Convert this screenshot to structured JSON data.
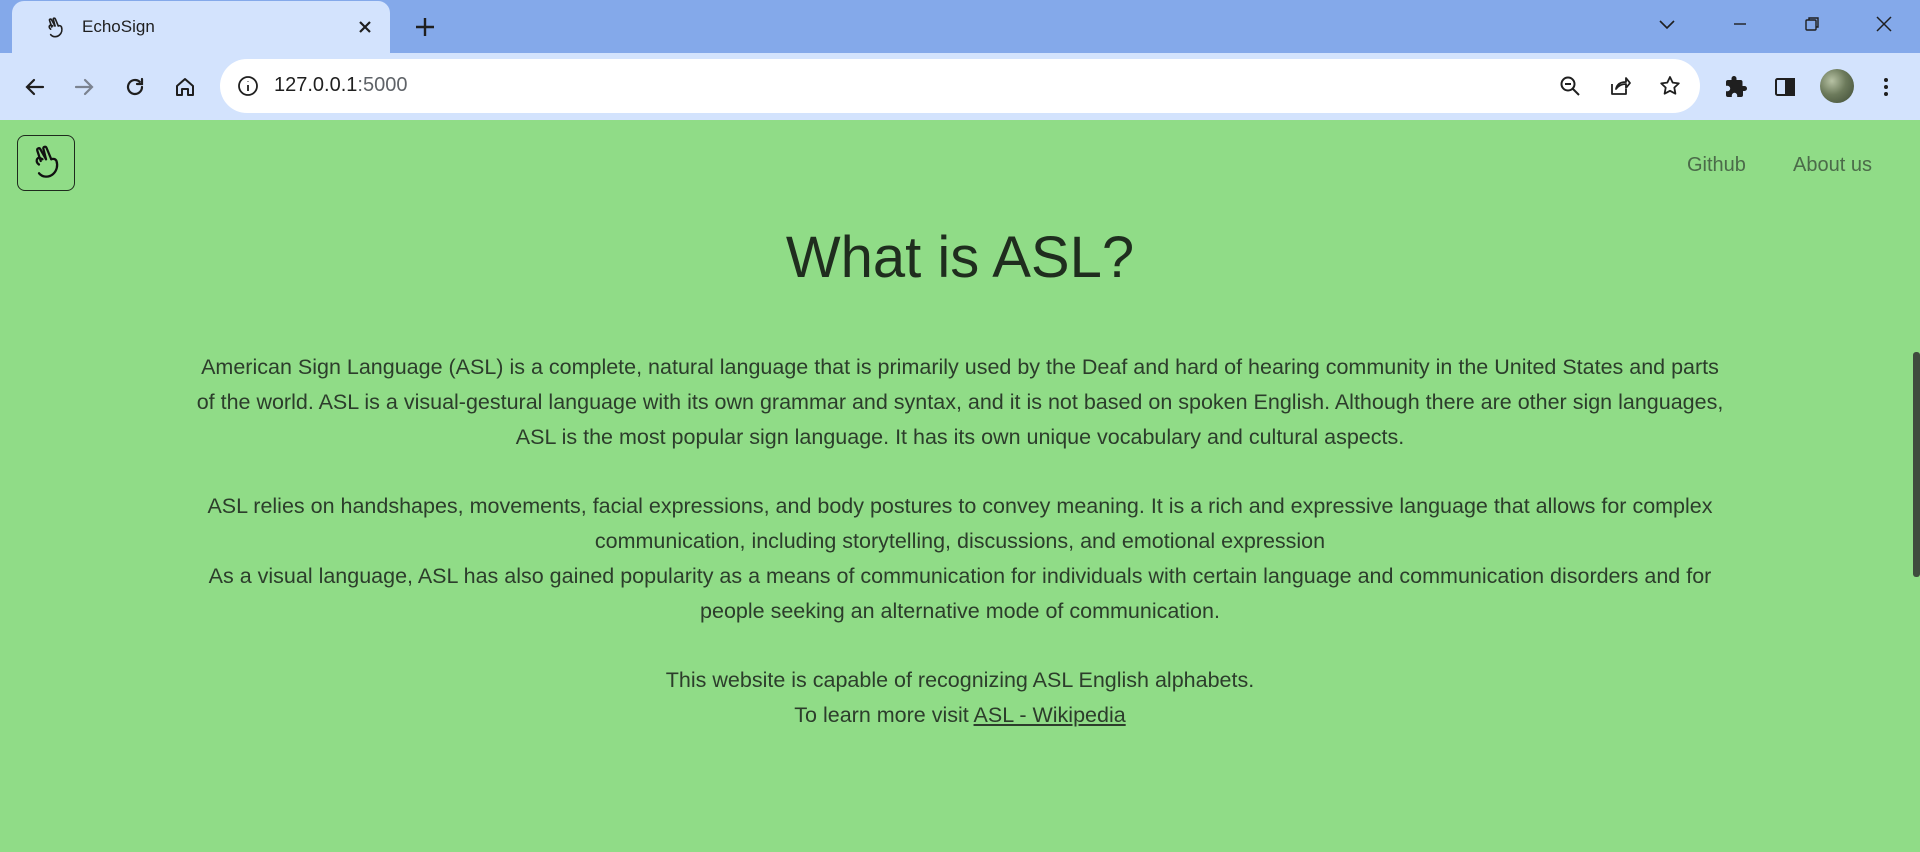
{
  "browser": {
    "tab_title": "EchoSign",
    "url_host": "127.0.0.1",
    "url_port": ":5000"
  },
  "nav": {
    "github": "Github",
    "about": "About us"
  },
  "content": {
    "heading": "What is ASL?",
    "p1": "American Sign Language (ASL) is a complete, natural language that is primarily used by the Deaf and hard of hearing community in the United States and parts of the world. ASL is a visual-gestural language with its own grammar and syntax, and it is not based on spoken English. Although there are other sign languages, ASL is the most popular sign language. It has its own unique vocabulary and cultural aspects.",
    "p2a": "ASL relies on handshapes, movements, facial expressions, and body postures to convey meaning. It is a rich and expressive language that allows for complex communication, including storytelling, discussions, and emotional expression",
    "p2b": "As a visual language, ASL has also gained popularity as a means of communication for individuals with certain language and communication disorders and for people seeking an alternative mode of communication.",
    "p3": "This website is capable of recognizing ASL English alphabets.",
    "p4_prefix": "To learn more visit ",
    "p4_link": "ASL - Wikipedia"
  },
  "colors": {
    "page_bg": "#90dc87",
    "tabbar_bg": "#84a9ea",
    "toolbar_bg": "#d3e3fd"
  },
  "icons": [
    "hand-sign-icon",
    "close-icon",
    "plus-icon",
    "chevron-down-icon",
    "minimize-icon",
    "restore-icon",
    "window-close-icon",
    "back-icon",
    "forward-icon",
    "reload-icon",
    "home-icon",
    "info-icon",
    "zoom-out-icon",
    "share-icon",
    "star-icon",
    "extensions-icon",
    "side-panel-icon",
    "menu-icon"
  ]
}
